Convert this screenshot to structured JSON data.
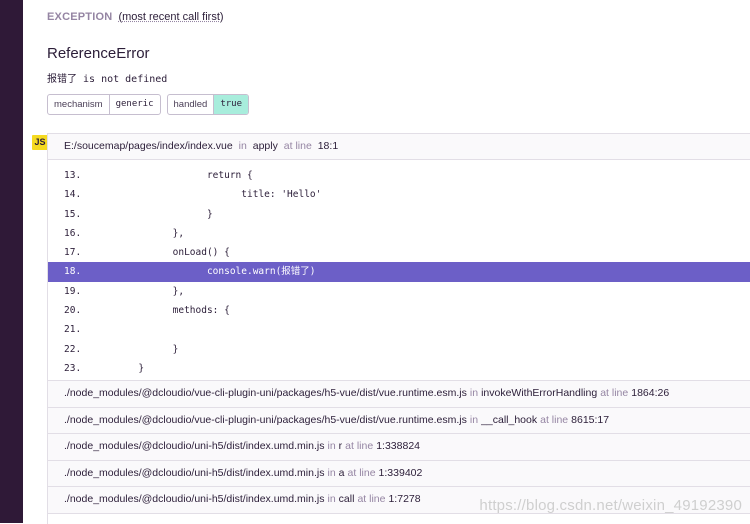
{
  "exception": {
    "label": "EXCEPTION",
    "sublabel": "(most recent call first)",
    "type": "ReferenceError",
    "message": "报错了 is not defined"
  },
  "tags": [
    {
      "key": "mechanism",
      "value": "generic",
      "highlight": false
    },
    {
      "key": "handled",
      "value": "true",
      "highlight": true
    }
  ],
  "language_badge": "JS",
  "top_frame": {
    "file": "E:/soucemap/pages/index/index.vue",
    "in_text": "in",
    "function": "apply",
    "at_text": "at line",
    "line": "18:1"
  },
  "code_lines": [
    {
      "num": "13.",
      "code": "\t\t\treturn {"
    },
    {
      "num": "14.",
      "code": "\t\t\t\ttitle: 'Hello'"
    },
    {
      "num": "15.",
      "code": "\t\t\t}"
    },
    {
      "num": "16.",
      "code": "\t\t},"
    },
    {
      "num": "17.",
      "code": "\t\tonLoad() {"
    },
    {
      "num": "18.",
      "code": "\t\t\tconsole.warn(报错了)",
      "active": true
    },
    {
      "num": "19.",
      "code": "\t\t},"
    },
    {
      "num": "20.",
      "code": "\t\tmethods: {"
    },
    {
      "num": "21.",
      "code": ""
    },
    {
      "num": "22.",
      "code": "\t\t}"
    },
    {
      "num": "23.",
      "code": "\t}"
    }
  ],
  "frames": [
    {
      "file": "./node_modules/@dcloudio/vue-cli-plugin-uni/packages/h5-vue/dist/vue.runtime.esm.js",
      "function": "invokeWithErrorHandling",
      "line": "1864:26"
    },
    {
      "file": "./node_modules/@dcloudio/vue-cli-plugin-uni/packages/h5-vue/dist/vue.runtime.esm.js",
      "function": "__call_hook",
      "line": "8615:17"
    },
    {
      "file": "./node_modules/@dcloudio/uni-h5/dist/index.umd.min.js",
      "function": "r",
      "line": "1:338824"
    },
    {
      "file": "./node_modules/@dcloudio/uni-h5/dist/index.umd.min.js",
      "function": "a",
      "line": "1:339402"
    },
    {
      "file": "./node_modules/@dcloudio/uni-h5/dist/index.umd.min.js",
      "function": "call",
      "line": "1:7278"
    }
  ],
  "frame_in_text": "in",
  "frame_at_text": "at line",
  "watermark": "https://blog.csdn.net/weixin_49192390",
  "colors": {
    "left_bar": "#2f1937",
    "active_line": "#6c5fc7",
    "tag_highlight": "#a8eddc",
    "js_badge": "#f5da21"
  }
}
